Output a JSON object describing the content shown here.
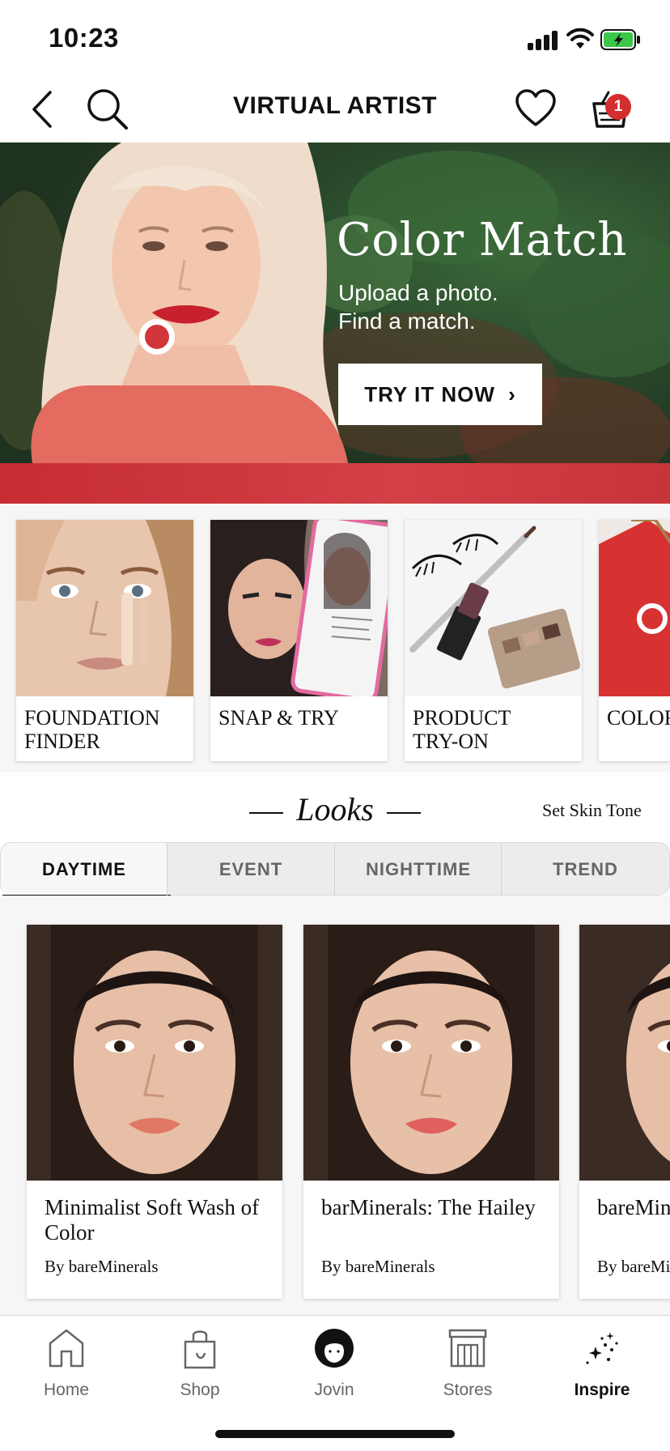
{
  "status_bar": {
    "time": "10:23",
    "signal_icon": "cellular-signal-icon",
    "wifi_icon": "wifi-icon",
    "battery_icon": "battery-charging-icon"
  },
  "nav": {
    "title": "VIRTUAL ARTIST",
    "back_icon": "chevron-left-icon",
    "search_icon": "search-icon",
    "favorites_icon": "heart-icon",
    "basket_icon": "basket-icon",
    "basket_count": "1"
  },
  "hero": {
    "title": "Color Match",
    "subtitle": "Upload a photo.\nFind a match.",
    "cta_label": "TRY IT NOW",
    "cta_icon": "chevron-right-icon"
  },
  "tools": [
    {
      "label": "FOUNDATION\nFINDER"
    },
    {
      "label": "SNAP & TRY"
    },
    {
      "label": "PRODUCT\nTRY-ON"
    },
    {
      "label": "COLOR"
    }
  ],
  "looks": {
    "title": "Looks",
    "skin_tone_link": "Set Skin Tone",
    "tabs": [
      "DAYTIME",
      "EVENT",
      "NIGHTTIME",
      "TREND"
    ],
    "active_tab": "DAYTIME",
    "cards": [
      {
        "name": "Minimalist Soft Wash of Color",
        "brand": "By bareMinerals"
      },
      {
        "name": "barMinerals: The Hailey",
        "brand": "By bareMinerals"
      },
      {
        "name": "bareMinerals: Cool Sn",
        "brand": "By bareMinerals"
      }
    ]
  },
  "tab_bar": {
    "items": [
      {
        "label": "Home",
        "icon": "home-icon"
      },
      {
        "label": "Shop",
        "icon": "shopping-bag-icon"
      },
      {
        "label": "Jovin",
        "icon": "avatar-icon"
      },
      {
        "label": "Stores",
        "icon": "store-icon"
      },
      {
        "label": "Inspire",
        "icon": "sparkles-icon"
      }
    ],
    "active": "Inspire"
  },
  "colors": {
    "accent_red": "#d3363a",
    "badge_red": "#d32f2f",
    "text_dark": "#111111",
    "tab_inactive": "#666666"
  }
}
